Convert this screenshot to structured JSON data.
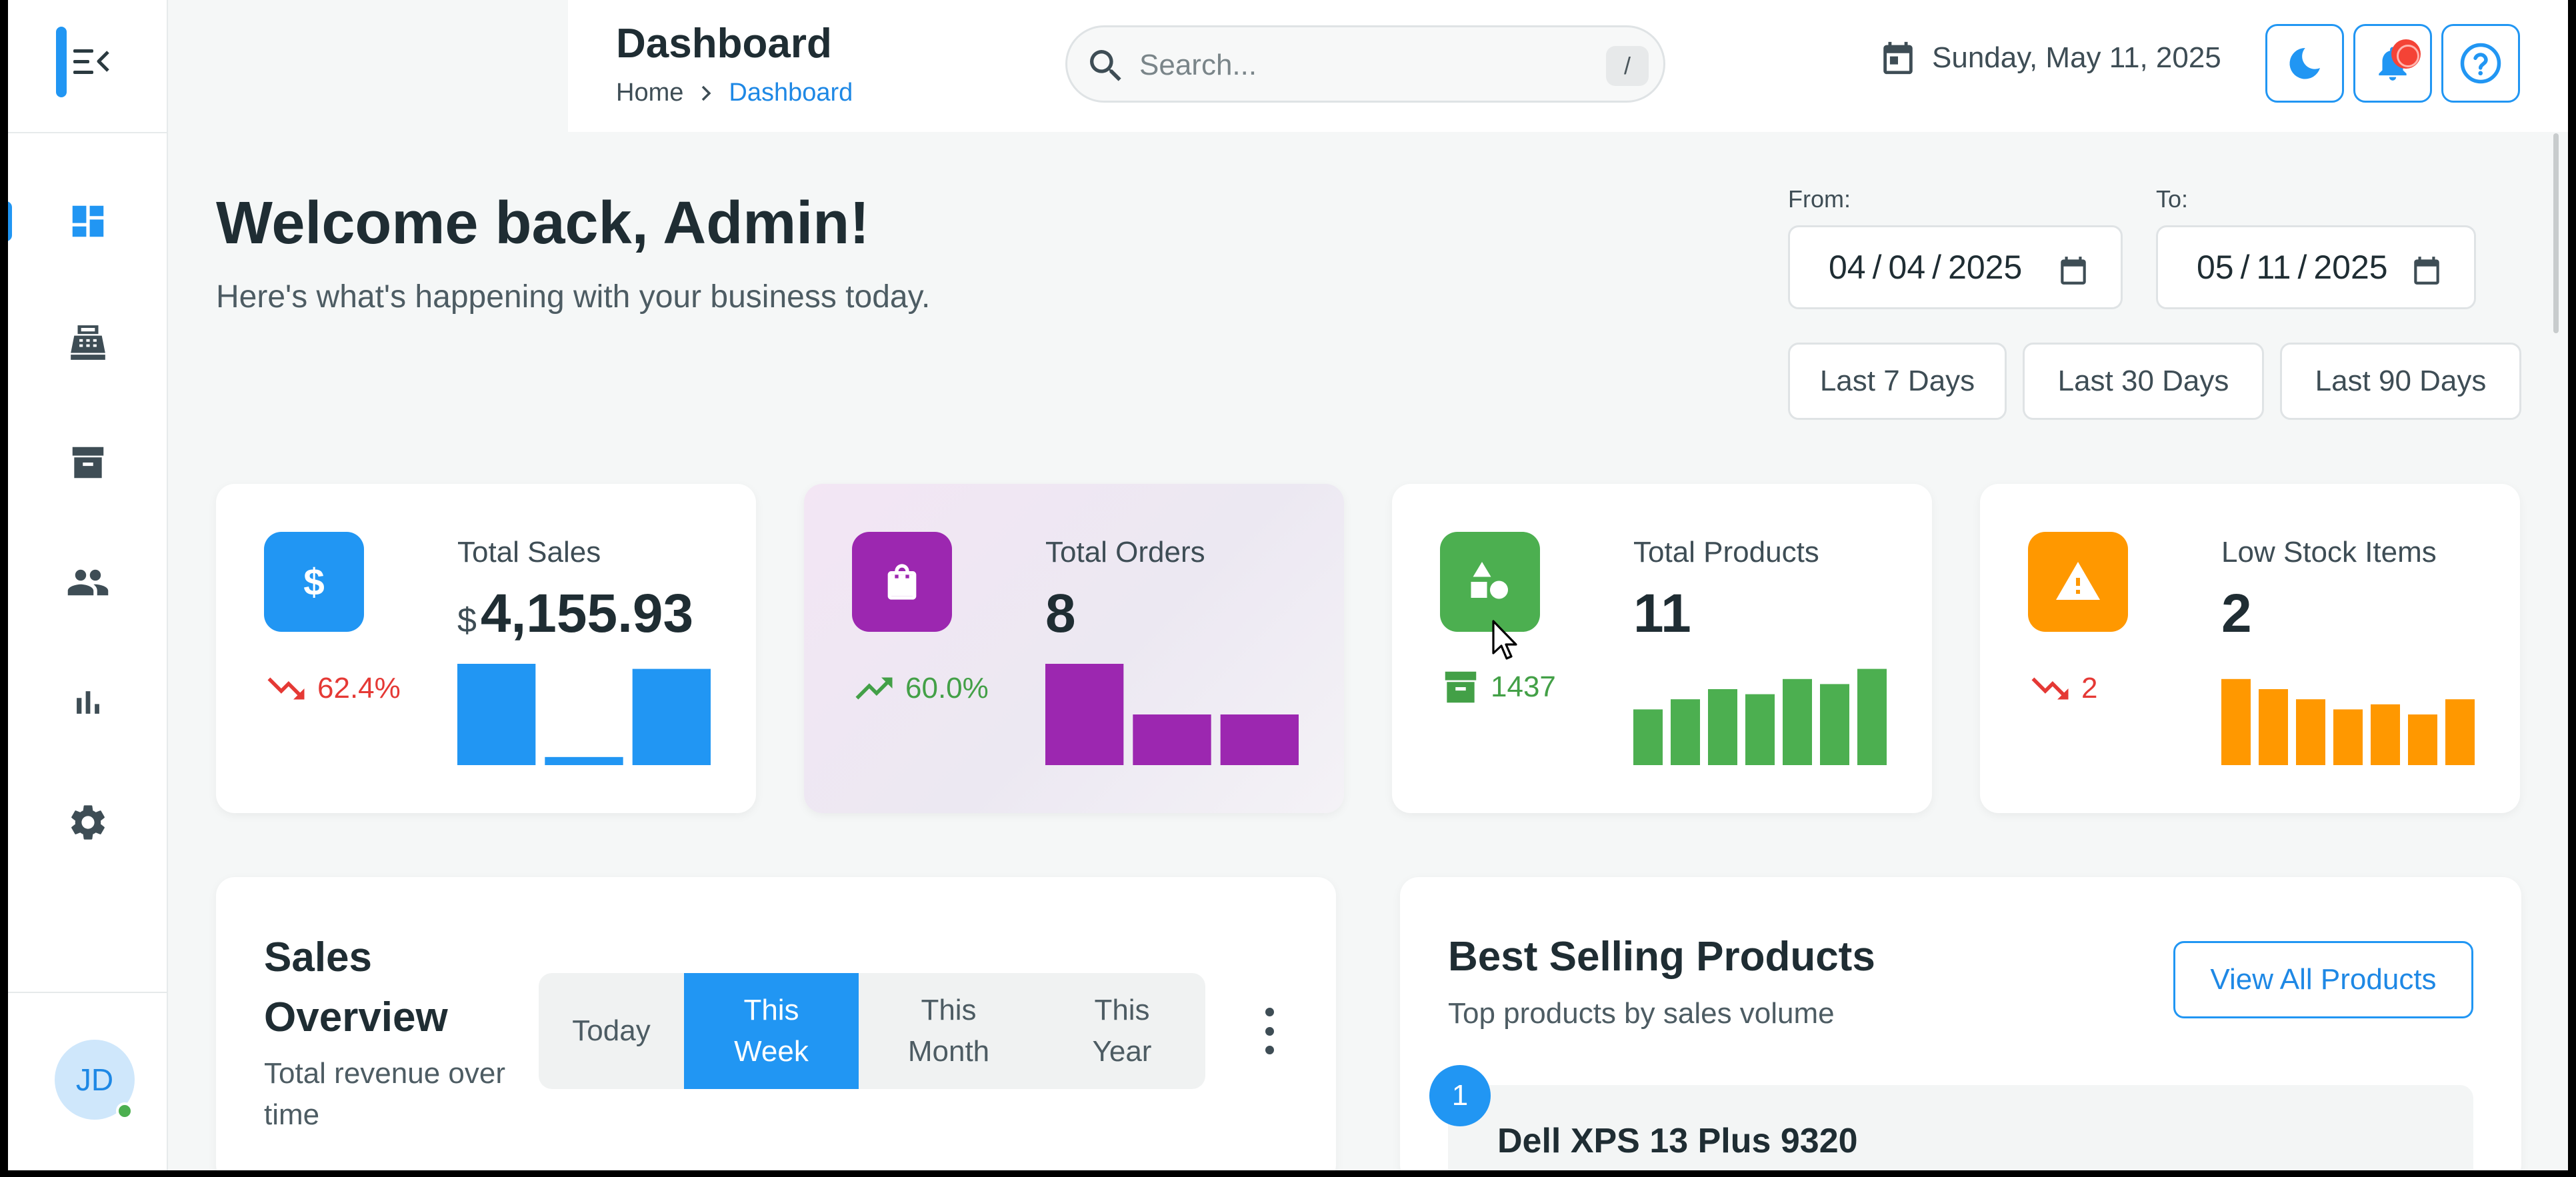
{
  "header": {
    "title": "Dashboard",
    "breadcrumb": {
      "home": "Home",
      "current": "Dashboard"
    },
    "search_placeholder": "Search...",
    "search_shortcut": "/",
    "date": "Sunday, May 11, 2025",
    "buttons": [
      "dark-mode-toggle",
      "notifications",
      "help"
    ]
  },
  "sidebar": {
    "items": [
      {
        "name": "dashboard",
        "icon": "dashboard-icon",
        "active": true
      },
      {
        "name": "pos",
        "icon": "cash-register-icon"
      },
      {
        "name": "inventory",
        "icon": "archive-icon"
      },
      {
        "name": "customers",
        "icon": "people-icon"
      },
      {
        "name": "reports",
        "icon": "bar-chart-icon"
      },
      {
        "name": "settings",
        "icon": "gear-icon"
      }
    ],
    "avatar": {
      "initials": "JD",
      "status": "online"
    }
  },
  "welcome": {
    "title": "Welcome back, Admin!",
    "subtitle": "Here's what's happening with your business today."
  },
  "date_range": {
    "from_label": "From:",
    "from": {
      "mm": "04",
      "dd": "04",
      "yyyy": "2025"
    },
    "to_label": "To:",
    "to": {
      "mm": "05",
      "dd": "11",
      "yyyy": "2025"
    },
    "presets": [
      "Last 7 Days",
      "Last 30 Days",
      "Last 90 Days"
    ]
  },
  "stats": [
    {
      "label": "Total Sales",
      "currency": "$",
      "value": "4,155.93",
      "trend": "62.4%",
      "trend_direction": "down",
      "color": "#2196f3",
      "icon": "dollar-icon",
      "bars": [
        1.0,
        0.08,
        0.95
      ]
    },
    {
      "label": "Total Orders",
      "value": "8",
      "trend": "60.0%",
      "trend_direction": "up",
      "color": "#9c27b0",
      "icon": "shopping-bag-icon",
      "bars": [
        1.0,
        0.5,
        0.5
      ]
    },
    {
      "label": "Total Products",
      "value": "11",
      "trend": "1437",
      "trend_direction": "stock",
      "color": "#4caf50",
      "icon": "shapes-icon",
      "bars": [
        0.55,
        0.65,
        0.75,
        0.7,
        0.85,
        0.8,
        0.95
      ]
    },
    {
      "label": "Low Stock Items",
      "value": "2",
      "trend": "2",
      "trend_direction": "down",
      "color": "#ff9800",
      "icon": "warning-icon",
      "bars": [
        0.85,
        0.75,
        0.65,
        0.55,
        0.6,
        0.5,
        0.65
      ]
    }
  ],
  "colors": {
    "accent": "#2196f3",
    "down": "#e53935",
    "up": "#43a047"
  },
  "sales_overview": {
    "title": "Sales Overview",
    "subtitle": "Total revenue over time",
    "tabs": [
      "Today",
      "This Week",
      "This Month",
      "This Year"
    ],
    "active_tab": "This Week"
  },
  "best_selling": {
    "title": "Best Selling Products",
    "subtitle": "Top products by sales volume",
    "view_all": "View All Products",
    "items": [
      {
        "rank": "1",
        "name": "Dell XPS 13 Plus 9320"
      }
    ]
  }
}
